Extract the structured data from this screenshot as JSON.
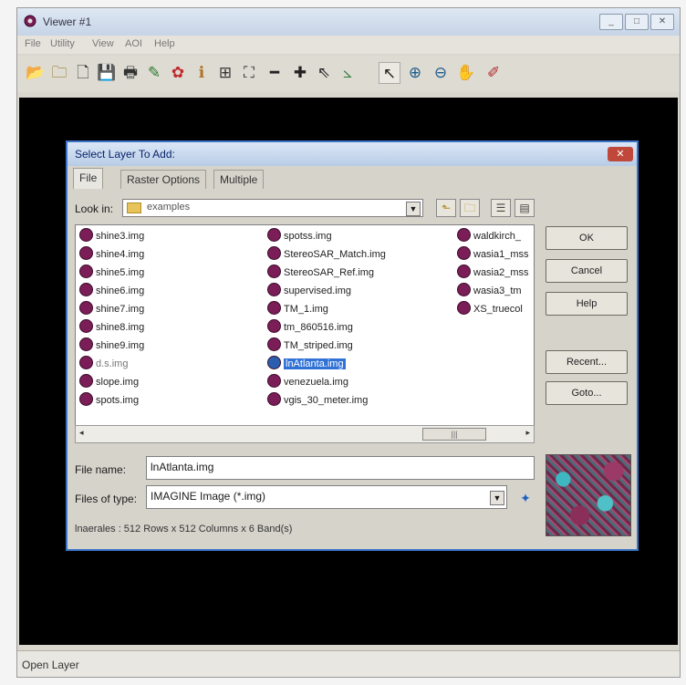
{
  "window": {
    "title": "Viewer #1",
    "controls": [
      "_",
      "□",
      "✕"
    ]
  },
  "menubar": [
    "File",
    "Utility",
    "View",
    "AOI",
    "Help"
  ],
  "toolbar": [
    {
      "icon": "open-folder-icon",
      "glyph": "📂"
    },
    {
      "icon": "open-raster-icon",
      "glyph": "🗀"
    },
    {
      "icon": "new-doc-icon",
      "glyph": "🗋"
    },
    {
      "icon": "save-icon",
      "glyph": "💾"
    },
    {
      "icon": "print-icon",
      "glyph": "🖶"
    },
    {
      "icon": "pencil-icon",
      "glyph": "✎"
    },
    {
      "icon": "palette-icon",
      "glyph": "✿"
    },
    {
      "icon": "info-icon",
      "glyph": "ℹ"
    },
    {
      "icon": "grid-icon",
      "glyph": "⊞"
    },
    {
      "icon": "fit-icon",
      "glyph": "⛶"
    },
    {
      "icon": "minus-icon",
      "glyph": "━"
    },
    {
      "icon": "plus-icon",
      "glyph": "✚"
    },
    {
      "icon": "inquire-icon",
      "glyph": "⇖"
    },
    {
      "icon": "chart-icon",
      "glyph": "⦣"
    },
    {
      "icon": "pointer-icon",
      "glyph": "↖"
    },
    {
      "icon": "zoom-in-icon",
      "glyph": "⊕"
    },
    {
      "icon": "zoom-out-icon",
      "glyph": "⊖"
    },
    {
      "icon": "pan-icon",
      "glyph": "✋"
    },
    {
      "icon": "pin-icon",
      "glyph": "✐"
    }
  ],
  "status": "Open Layer",
  "dialog": {
    "title": "Select Layer To Add:",
    "close": "✕",
    "tabs": [
      "File",
      "Raster Options",
      "Multiple"
    ],
    "look_in_label": "Look in:",
    "look_in_value": "examples",
    "file_name_label": "File name:",
    "file_name_value": "lnAtlanta.img",
    "files_of_type_label": "Files of type:",
    "files_of_type_value": "IMAGINE Image (*.img)",
    "info": "lnaerales : 512 Rows x 512 Columns x 6 Band(s)",
    "buttons": {
      "ok": "OK",
      "cancel": "Cancel",
      "help": "Help",
      "recent": "Recent...",
      "goto": "Goto..."
    },
    "files": {
      "col1": [
        "shine3.img",
        "shine4.img",
        "shine5.img",
        "shine6.img",
        "shine7.img",
        "shine8.img",
        "shine9.img",
        "slope.img",
        "spots.img"
      ],
      "col2": [
        "spotss.img",
        "StereoSAR_Match.img",
        "StereoSAR_Ref.img",
        "supervised.img",
        "TM_1.img",
        "tm_860516.img",
        "TM_striped.img",
        "lnAtlanta.img",
        "venezuela.img",
        "vgis_30_meter.img"
      ],
      "col3": [
        "waldkirch_",
        "wasia1_mss",
        "wasia2_mss",
        "wasia3_tm",
        "XS_truecol"
      ],
      "garbled_entry": "d.s.img",
      "selected": "lnAtlanta.img"
    }
  }
}
